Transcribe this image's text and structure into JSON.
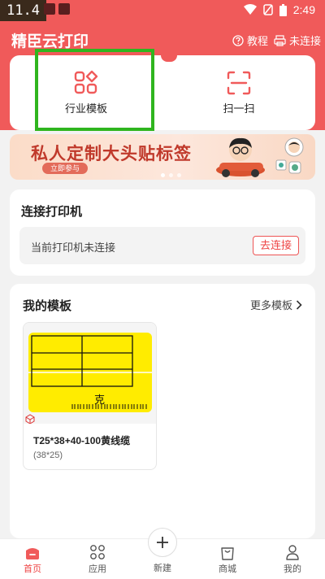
{
  "status_bar": {
    "time_badge": "11.4",
    "clock": "2:49"
  },
  "header": {
    "title": "精臣云打印",
    "tutorial_label": "教程",
    "connection_label": "未连接"
  },
  "tools": [
    {
      "label": "行业模板",
      "icon": "grid-shapes-icon"
    },
    {
      "label": "扫一扫",
      "icon": "scan-icon"
    }
  ],
  "banner": {
    "title": "私人定制大头贴标签",
    "button": "立即参与",
    "dots": 3,
    "active_dot": 0
  },
  "printer": {
    "title": "连接打印机",
    "status": "当前打印机未连接",
    "connect_button": "去连接"
  },
  "templates": {
    "title": "我的模板",
    "more_label": "更多模板",
    "items": [
      {
        "name": "T25*38+40-100黄线缆",
        "size": "(38*25)",
        "thumb_text": "克"
      }
    ]
  },
  "bottom_nav": {
    "items": [
      {
        "label": "首页",
        "icon": "home-icon",
        "active": true
      },
      {
        "label": "应用",
        "icon": "apps-icon",
        "active": false
      },
      {
        "label": "新建",
        "icon": "plus-icon",
        "active": false
      },
      {
        "label": "商城",
        "icon": "shop-bag-icon",
        "active": false
      },
      {
        "label": "我的",
        "icon": "person-icon",
        "active": false
      }
    ]
  },
  "colors": {
    "brand_red": "#f05a5a",
    "highlight_green": "#2fb51e",
    "label_yellow": "#ffec00"
  }
}
